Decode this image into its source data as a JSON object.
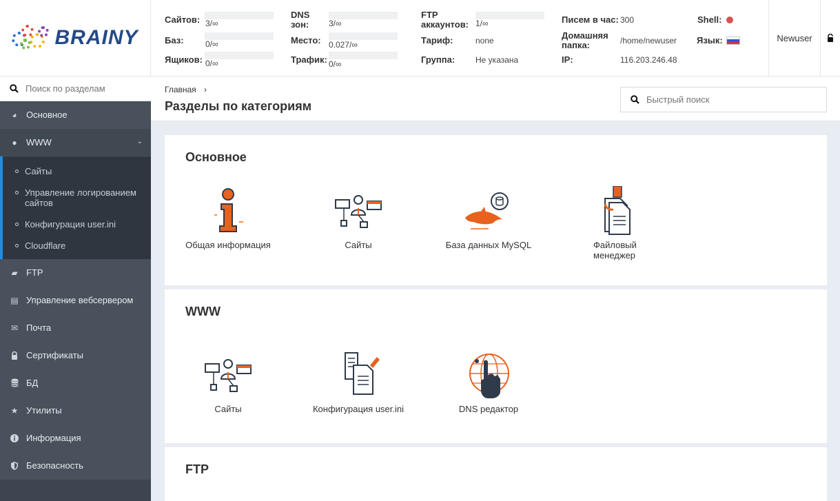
{
  "header": {
    "logo": "BRAINY",
    "stats": {
      "sites_label": "Сайтов:",
      "sites_value": "3/∞",
      "db_label": "Баз:",
      "db_value": "0/∞",
      "mail_label": "Ящиков:",
      "mail_value": "0/∞",
      "dns_label": "DNS зон:",
      "dns_value": "3/∞",
      "space_label": "Место:",
      "space_value": "0.027/∞",
      "traffic_label": "Трафик:",
      "traffic_value": "0/∞",
      "ftp_label": "FTP аккаунтов:",
      "ftp_value": "1/∞",
      "tariff_label": "Тариф:",
      "tariff_value": "none",
      "group_label": "Группа:",
      "group_value": "Не указана",
      "mail_hour_label": "Писем в час:",
      "mail_hour_value": "300",
      "home_label": "Домашняя папка:",
      "home_value": "/home/newuser",
      "ip_label": "IP:",
      "ip_value": "116.203.246.48",
      "shell_label": "Shell:",
      "lang_label": "Язык:"
    },
    "user": "Newuser"
  },
  "sidebar": {
    "search_placeholder": "Поиск по разделам",
    "items": [
      {
        "label": "Основное"
      },
      {
        "label": "WWW"
      },
      {
        "label": "FTP"
      },
      {
        "label": "Управление вебсервером"
      },
      {
        "label": "Почта"
      },
      {
        "label": "Сертификаты"
      },
      {
        "label": "БД"
      },
      {
        "label": "Утилиты"
      },
      {
        "label": "Информация"
      },
      {
        "label": "Безопасность"
      }
    ],
    "submenu": [
      {
        "label": "Сайты"
      },
      {
        "label": "Управление логированием сайтов"
      },
      {
        "label": "Конфигурация user.ini"
      },
      {
        "label": "Cloudflare"
      }
    ]
  },
  "content": {
    "breadcrumb": "Главная",
    "title": "Разделы по категориям",
    "quick_search_placeholder": "Быстрый поиск",
    "sections": [
      {
        "title": "Основное",
        "tiles": [
          {
            "label": "Общая информация"
          },
          {
            "label": "Сайты"
          },
          {
            "label": "База данных MySQL"
          },
          {
            "label": "Файловый менеджер"
          }
        ]
      },
      {
        "title": "WWW",
        "tiles": [
          {
            "label": "Сайты"
          },
          {
            "label": "Конфигурация user.ini"
          },
          {
            "label": "DNS редактор"
          }
        ]
      },
      {
        "title": "FTP"
      }
    ]
  },
  "colors": {
    "accent_orange": "#e8621e",
    "icon_dark": "#2f3b4a",
    "sidebar_bg": "#48515c",
    "submenu_bg": "#2f363f",
    "active_border": "#1f8ce6",
    "shell_dot": "#d9534f",
    "logo_blue": "#244a86"
  }
}
